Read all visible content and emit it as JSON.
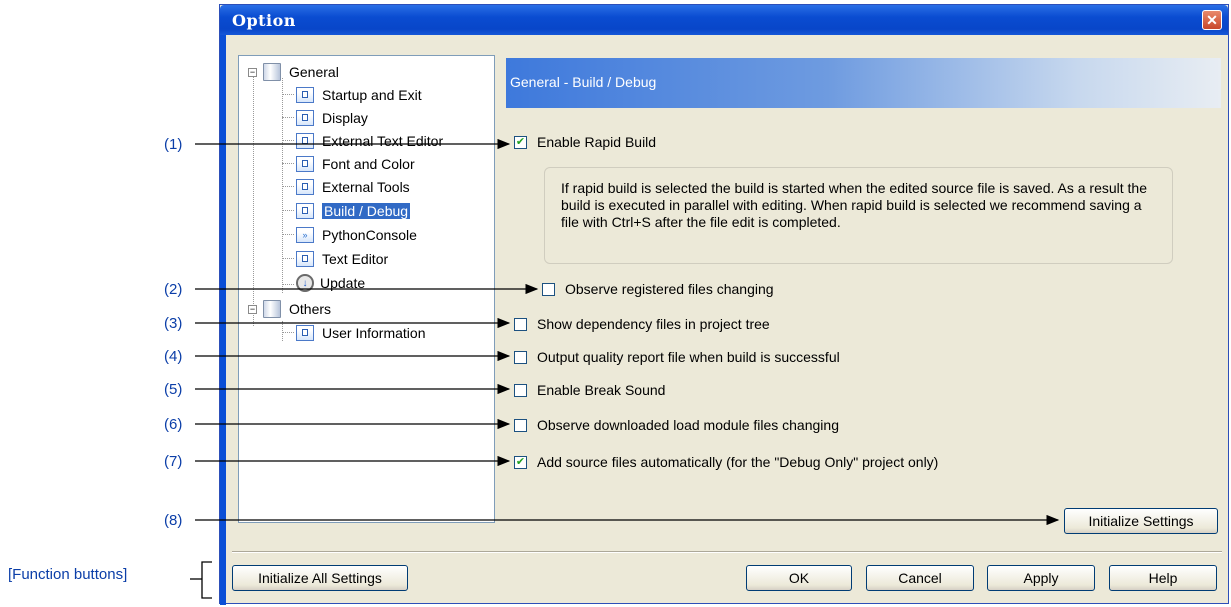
{
  "window": {
    "title": "Option"
  },
  "icons": {
    "close": "close-icon"
  },
  "tree": {
    "general": "General",
    "general_items": [
      "Startup and Exit",
      "Display",
      "External Text Editor",
      "Font and Color",
      "External Tools",
      "Build / Debug",
      "PythonConsole",
      "Text Editor",
      "Update"
    ],
    "others": "Others",
    "others_items": [
      "User Information"
    ]
  },
  "panel": {
    "header": "General - Build / Debug",
    "enable_rapid_build": "Enable Rapid Build",
    "rapid_build_info": "If rapid build is selected the build is started when the edited source file is saved. As a result the build is executed in parallel with editing. When rapid build is selected we recommend saving a file with Ctrl+S after the file edit is completed.",
    "observe_registered": "Observe registered files changing",
    "show_dependency": "Show dependency files in project tree",
    "output_quality": "Output quality report file when build is successful",
    "enable_break_sound": "Enable Break Sound",
    "observe_downloaded": "Observe downloaded load module files changing",
    "add_source_files": "Add source files automatically (for the \"Debug Only\" project only)",
    "initialize_settings": "Initialize Settings"
  },
  "checked": {
    "enable_rapid_build": true,
    "observe_registered": false,
    "show_dependency": false,
    "output_quality": false,
    "enable_break_sound": false,
    "observe_downloaded": false,
    "add_source_files": true
  },
  "buttons": {
    "initialize_all": "Initialize All Settings",
    "ok": "OK",
    "cancel": "Cancel",
    "apply": "Apply",
    "help": "Help"
  },
  "callouts": [
    "(1)",
    "(2)",
    "(3)",
    "(4)",
    "(5)",
    "(6)",
    "(7)",
    "(8)"
  ],
  "function_buttons_label": "[Function buttons]"
}
